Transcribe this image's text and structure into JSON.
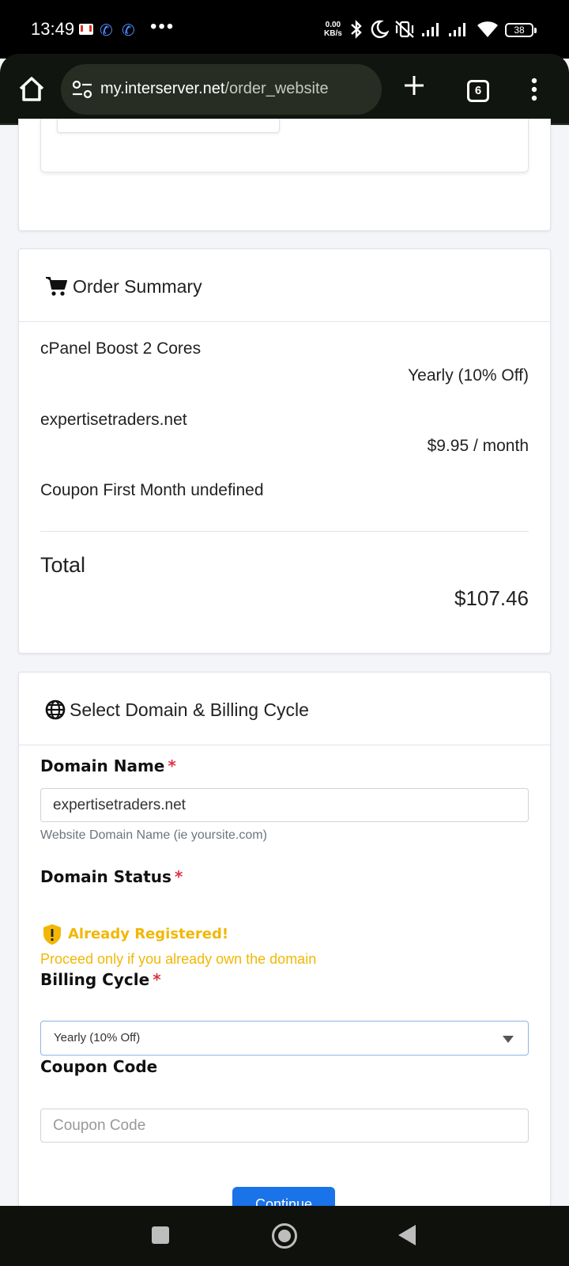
{
  "status_bar": {
    "time": "13:49",
    "net_speed_value": "0.00",
    "net_speed_unit": "KB/s",
    "battery": "38",
    "icons": [
      "gmail-icon",
      "phone-icon",
      "phone-icon",
      "more-dots-icon",
      "bluetooth-icon",
      "moon-icon",
      "vibrate-off-icon",
      "signal-icon",
      "signal-icon",
      "wifi-icon",
      "battery-icon"
    ]
  },
  "browser": {
    "url_host": "my.interserver.net",
    "url_path": "/order_website",
    "tab_count": "6",
    "icons": [
      "home-icon",
      "site-settings-icon",
      "plus-icon",
      "tabs-icon",
      "menu-icon"
    ]
  },
  "order_summary": {
    "title": "Order Summary",
    "icon": "cart-icon",
    "items": [
      {
        "label": "cPanel Boost 2 Cores",
        "value": "Yearly (10% Off)"
      },
      {
        "label": "expertisetraders.net",
        "value": "$9.95 / month"
      },
      {
        "label": "Coupon First Month undefined",
        "value": ""
      }
    ],
    "total_label": "Total",
    "total_value": "$107.46"
  },
  "domain_section": {
    "title": "Select Domain & Billing Cycle",
    "icon": "globe-icon",
    "domain_name": {
      "label": "Domain Name",
      "required": "*",
      "value": "expertisetraders.net",
      "help": "Website Domain Name (ie yoursite.com)"
    },
    "domain_status": {
      "label": "Domain Status",
      "required": "*",
      "status_title": "Already Registered!",
      "status_message": "Proceed only if you already own the domain",
      "status_color": "#f2b705"
    },
    "billing_cycle": {
      "label": "Billing Cycle",
      "required": "*",
      "selected": "Yearly (10% Off)"
    },
    "coupon": {
      "label": "Coupon Code",
      "placeholder": "Coupon Code"
    },
    "continue_label": "Continue"
  },
  "colors": {
    "accent": "#1a73e8",
    "required": "#dc3545",
    "warning": "#f2b705"
  }
}
